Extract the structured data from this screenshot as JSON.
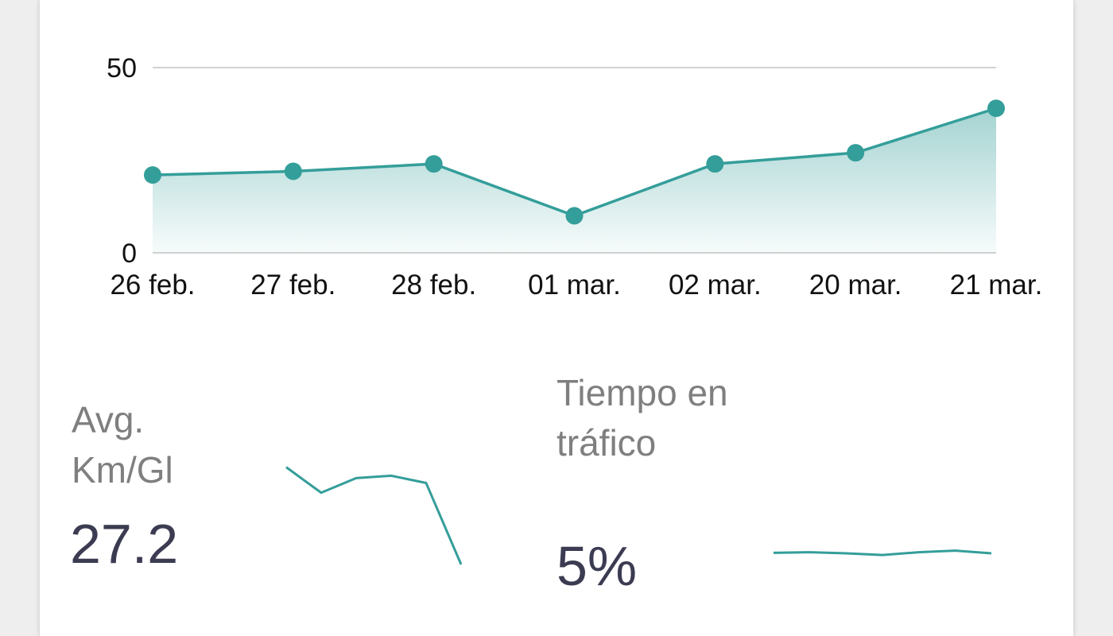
{
  "colors": {
    "accent": "#349e9a",
    "grid": "#b8b8b8",
    "label": "#7f7f7f",
    "value": "#3b3b52",
    "tick": "#111111"
  },
  "chart_data": [
    {
      "type": "area",
      "categories": [
        "26 feb.",
        "27 feb.",
        "28 feb.",
        "01 mar.",
        "02 mar.",
        "20 mar.",
        "21 mar."
      ],
      "values": [
        21,
        22,
        24,
        10,
        24,
        27,
        39
      ],
      "ylim": [
        0,
        50
      ],
      "yticks": [
        "0",
        "50"
      ],
      "grid": true,
      "markers": true
    },
    {
      "type": "line",
      "title": "",
      "values": [
        27.5,
        25.4,
        26.6,
        26.8,
        26.2,
        19.5
      ],
      "axes": false
    },
    {
      "type": "line",
      "values": [
        5.2,
        5.3,
        5.1,
        4.8,
        5.3,
        5.6,
        5.1
      ],
      "axes": false
    }
  ],
  "metrics": {
    "avg_km_gl": {
      "label": "Avg. Km/Gl",
      "value": "27.2"
    },
    "traffic": {
      "label": "Tiempo en tráfico",
      "value": "5%"
    }
  }
}
